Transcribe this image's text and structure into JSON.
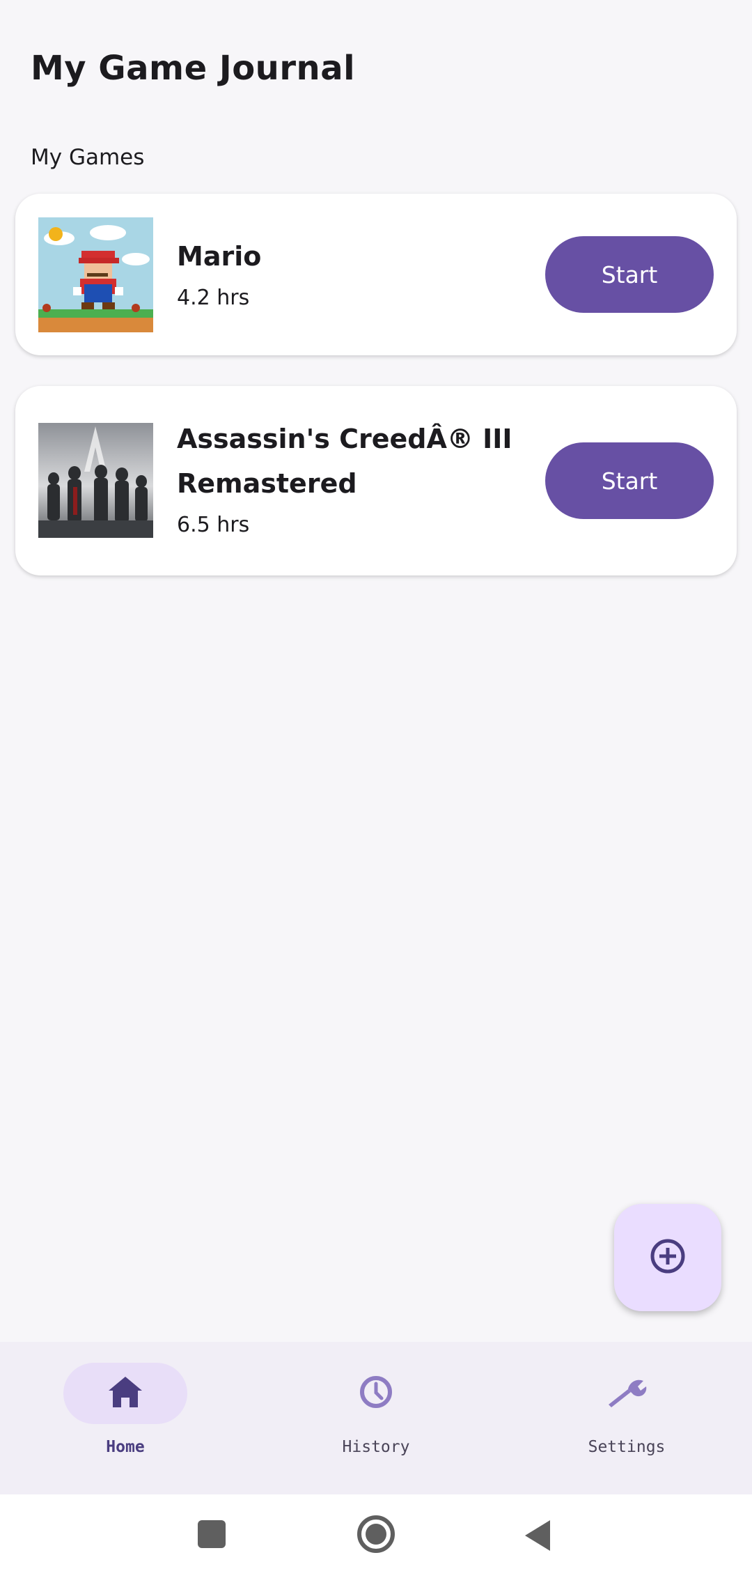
{
  "app": {
    "title": "My Game Journal"
  },
  "section": {
    "label": "My Games"
  },
  "games": [
    {
      "title": "Mario",
      "hours": "4.2 hrs",
      "action_label": "Start",
      "image_icon": "mario-thumbnail"
    },
    {
      "title": "Assassin's CreedÂ® III Remastered",
      "hours": "6.5 hrs",
      "action_label": "Start",
      "image_icon": "assassins-creed-thumbnail"
    }
  ],
  "fab": {
    "icon": "add-circle-icon"
  },
  "bottom_nav": {
    "items": [
      {
        "label": "Home",
        "icon": "home-icon",
        "selected": true
      },
      {
        "label": "History",
        "icon": "history-icon",
        "selected": false
      },
      {
        "label": "Settings",
        "icon": "wrench-icon",
        "selected": false
      }
    ]
  },
  "colors": {
    "primary": "#6750a4",
    "fab_bg": "#eaddff",
    "nav_selected_bg": "#e8def8",
    "background": "#f7f6f9"
  }
}
